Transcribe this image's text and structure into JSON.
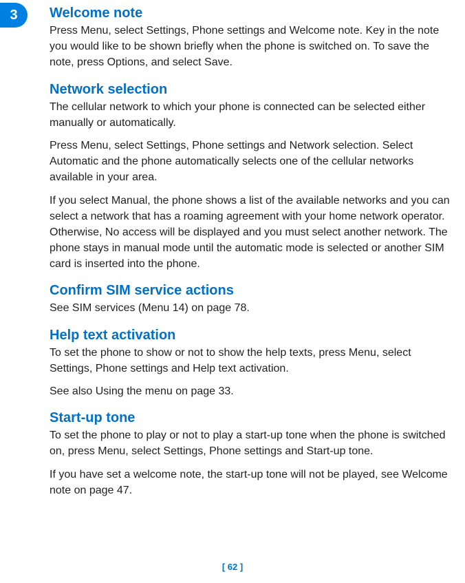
{
  "tab": {
    "number": "3"
  },
  "sections": {
    "welcome_note": {
      "heading": "Welcome note",
      "p1": "Press Menu, select Settings, Phone settings and Welcome note. Key in the note you would like to be shown briefly when the phone is switched on. To save the note, press Options, and select Save."
    },
    "network_selection": {
      "heading": "Network selection",
      "p1": "The cellular network to which your phone is connected can be selected either manually or automatically.",
      "p2": "Press Menu, select Settings, Phone settings and Network selection. Select Automatic and the phone automatically selects one of the cellular networks available in your area.",
      "p3": "If you select Manual, the phone shows a list of the available networks and you can select a network that has a roaming agreement with your home network operator. Otherwise, No access will be displayed and you must select another network. The phone stays in manual mode until the automatic mode is selected or another SIM card is inserted into the phone."
    },
    "confirm_sim": {
      "heading": "Confirm SIM service actions",
      "p1": "See SIM services (Menu 14) on page 78."
    },
    "help_text": {
      "heading": "Help text activation",
      "p1": "To set the phone to show or not to show the help texts, press Menu, select Settings, Phone settings and Help text activation.",
      "p2": "See also Using the menu on page 33."
    },
    "startup_tone": {
      "heading": "Start-up tone",
      "p1": "To set the phone to play or not to play a start-up tone when the phone is switched on, press Menu, select Settings, Phone settings and Start-up tone.",
      "p2": "If you have set a welcome note, the start-up tone will not be played, see Welcome note on page 47."
    }
  },
  "page_number": "[ 62 ]"
}
